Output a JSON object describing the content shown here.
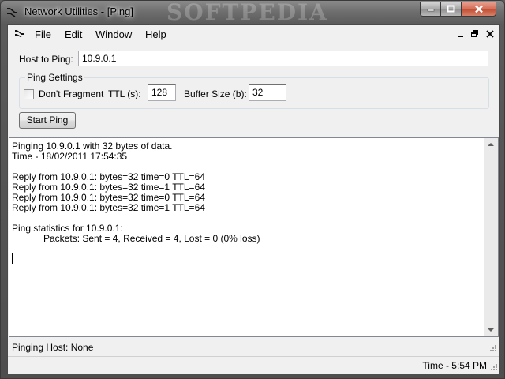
{
  "window": {
    "title": "Network Utilities - [Ping]",
    "watermark": "SOFTPEDIA"
  },
  "menu": {
    "items": [
      "File",
      "Edit",
      "Window",
      "Help"
    ]
  },
  "form": {
    "host_label": "Host to Ping:",
    "host_value": "10.9.0.1",
    "group_title": "Ping Settings",
    "dont_fragment_label": "Don't Fragment",
    "dont_fragment_checked": false,
    "ttl_label": "TTL (s):",
    "ttl_value": "128",
    "buffer_label": "Buffer Size (b):",
    "buffer_value": "32",
    "start_button": "Start Ping"
  },
  "output": {
    "lines": [
      "Pinging 10.9.0.1 with 32 bytes of data.",
      "Time - 18/02/2011 17:54:35",
      "",
      "Reply from 10.9.0.1: bytes=32 time=0 TTL=64",
      "Reply from 10.9.0.1: bytes=32 time=1 TTL=64",
      "Reply from 10.9.0.1: bytes=32 time=0 TTL=64",
      "Reply from 10.9.0.1: bytes=32 time=1 TTL=64",
      "",
      "Ping statistics for 10.9.0.1:",
      "            Packets: Sent = 4, Received = 4, Lost = 0 (0% loss)"
    ]
  },
  "status": {
    "pinging_host": "Pinging Host:  None",
    "time": "Time - 5:54 PM"
  },
  "colors": {
    "close_button": "#c75a40",
    "titlebar": "#6e6e6e"
  }
}
